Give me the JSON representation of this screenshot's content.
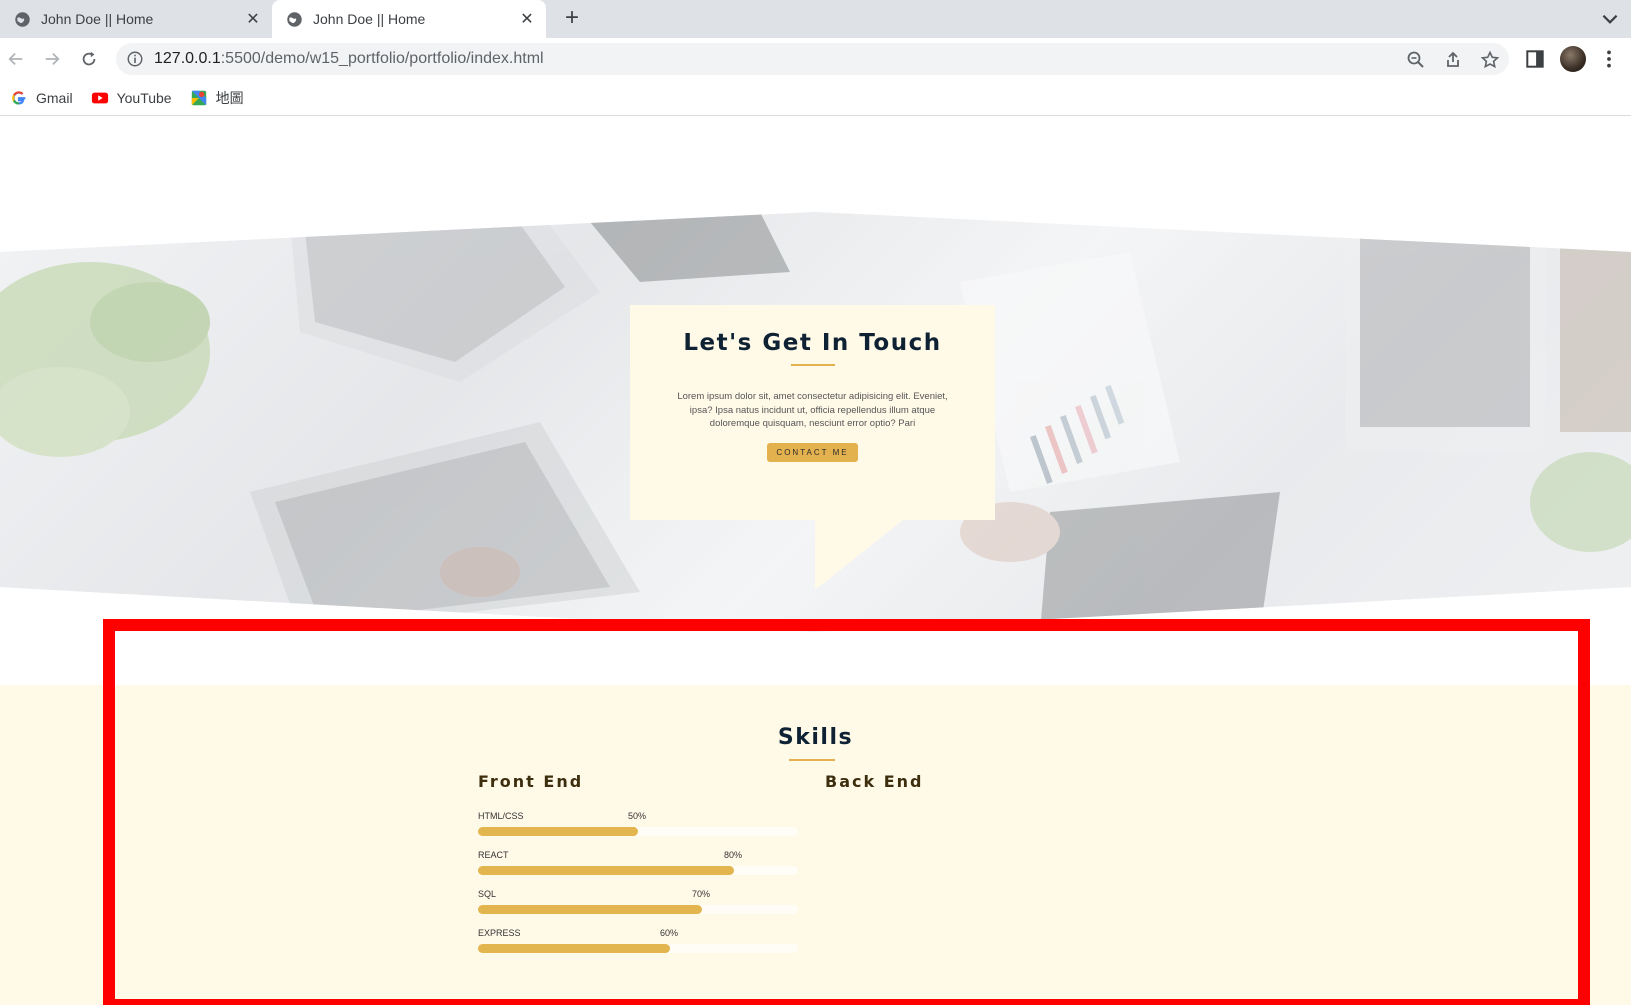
{
  "browser": {
    "tabs": [
      {
        "title": "John Doe || Home",
        "active": false
      },
      {
        "title": "John Doe || Home",
        "active": true
      }
    ],
    "url": {
      "host": "127.0.0.1",
      "rest": ":5500/demo/w15_portfolio/portfolio/index.html"
    },
    "bookmarks": [
      {
        "label": "Gmail",
        "icon": "google-icon"
      },
      {
        "label": "YouTube",
        "icon": "youtube-icon"
      },
      {
        "label": "地圖",
        "icon": "maps-icon"
      }
    ]
  },
  "contact": {
    "title": "Let's Get In Touch",
    "text": "Lorem ipsum dolor sit, amet consectetur adipisicing elit. Eveniet, ipsa? Ipsa natus incidunt ut, officia repellendus illum atque doloremque quisquam, nesciunt error optio? Pari",
    "button": "CONTACT ME"
  },
  "skills": {
    "title": "Skills",
    "front_title": "Front End",
    "back_title": "Back End",
    "front": [
      {
        "name": "HTML/CSS",
        "percent_label": "50%",
        "percent": 50
      },
      {
        "name": "REACT",
        "percent_label": "80%",
        "percent": 80
      },
      {
        "name": "SQL",
        "percent_label": "70%",
        "percent": 70
      },
      {
        "name": "EXPRESS",
        "percent_label": "60%",
        "percent": 60
      }
    ]
  },
  "colors": {
    "accent": "#e3b14d",
    "cream": "#fff9e8",
    "heading": "#0f2234",
    "highlight_frame": "#ff0000"
  }
}
